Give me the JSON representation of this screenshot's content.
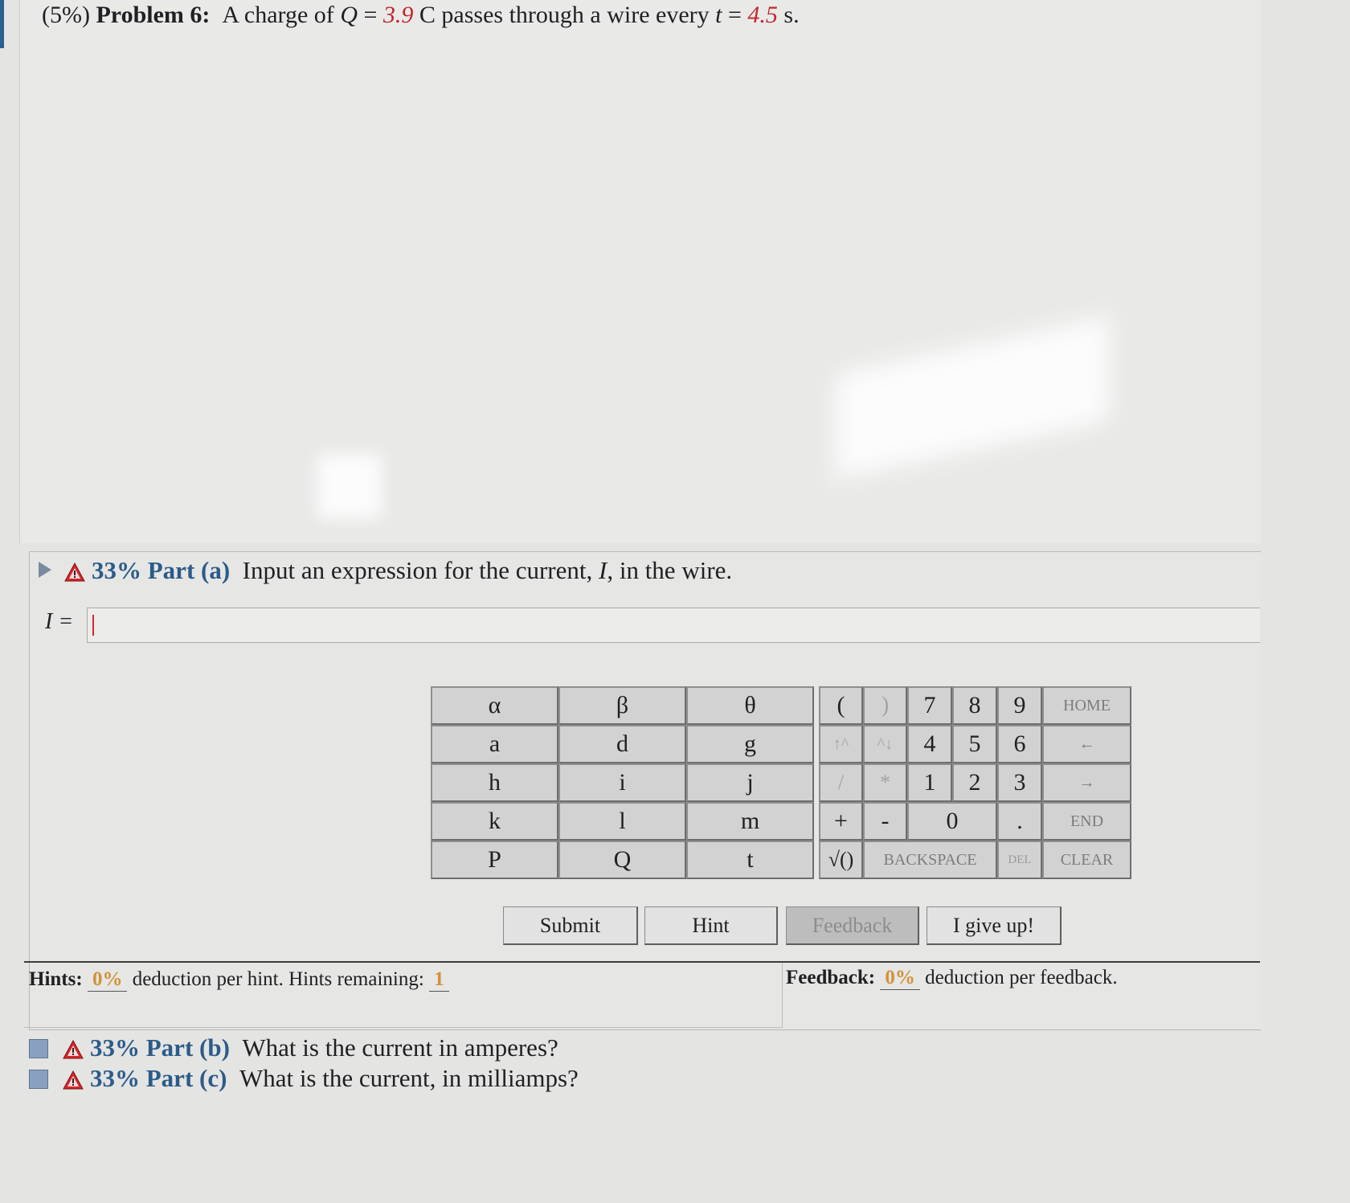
{
  "problem": {
    "percent": "(5%)",
    "label": "Problem 6:",
    "text_before_q": "A charge of",
    "q_var": "Q",
    "eq1": " = ",
    "q_val": "3.9",
    "unit_c": " C passes through a wire every ",
    "t_var": "t",
    "eq2": " = ",
    "t_val": "4.5",
    "unit_s": " s."
  },
  "part_a": {
    "percent": "33%",
    "label": "Part (a)",
    "prompt_before": "Input an expression for the current, ",
    "prompt_var": "I",
    "prompt_after": ", in the wire.",
    "answer_label": "I =",
    "answer_value": ""
  },
  "keypad": {
    "greek": [
      "α",
      "β",
      "θ"
    ],
    "letters": [
      [
        "a",
        "d",
        "g"
      ],
      [
        "h",
        "i",
        "j"
      ],
      [
        "k",
        "l",
        "m"
      ],
      [
        "P",
        "Q",
        "t"
      ]
    ],
    "paren_open": "(",
    "paren_close": ")",
    "up_arrows": "↑^",
    "down_arrows": "^↓",
    "divide": "/",
    "multiply": "*",
    "plus": "+",
    "minus": "-",
    "sqrt": "√()",
    "digits": {
      "row1": [
        "7",
        "8",
        "9"
      ],
      "row2": [
        "4",
        "5",
        "6"
      ],
      "row3": [
        "1",
        "2",
        "3"
      ],
      "zero": "0",
      "dot": "."
    },
    "home": "HOME",
    "left_arrow": "←",
    "right_arrow": "→",
    "end": "END",
    "backspace": "BACKSPACE",
    "del": "DEL",
    "clear": "CLEAR"
  },
  "buttons": {
    "submit": "Submit",
    "hint": "Hint",
    "feedback": "Feedback",
    "give_up": "I give up!"
  },
  "hints": {
    "label": "Hints:",
    "percent": "0%",
    "text": "deduction per hint. Hints remaining:",
    "remaining": "1"
  },
  "feedback": {
    "label": "Feedback:",
    "percent": "0%",
    "text": "deduction per feedback."
  },
  "other_parts": [
    {
      "percent": "33%",
      "label": "Part (b)",
      "question": "What is the current in amperes?"
    },
    {
      "percent": "33%",
      "label": "Part (c)",
      "question": "What is the current, in milliamps?"
    }
  ],
  "colors": {
    "value_red": "#c0262b",
    "part_blue": "#2c5b8a",
    "hint_orange": "#d1923a"
  }
}
